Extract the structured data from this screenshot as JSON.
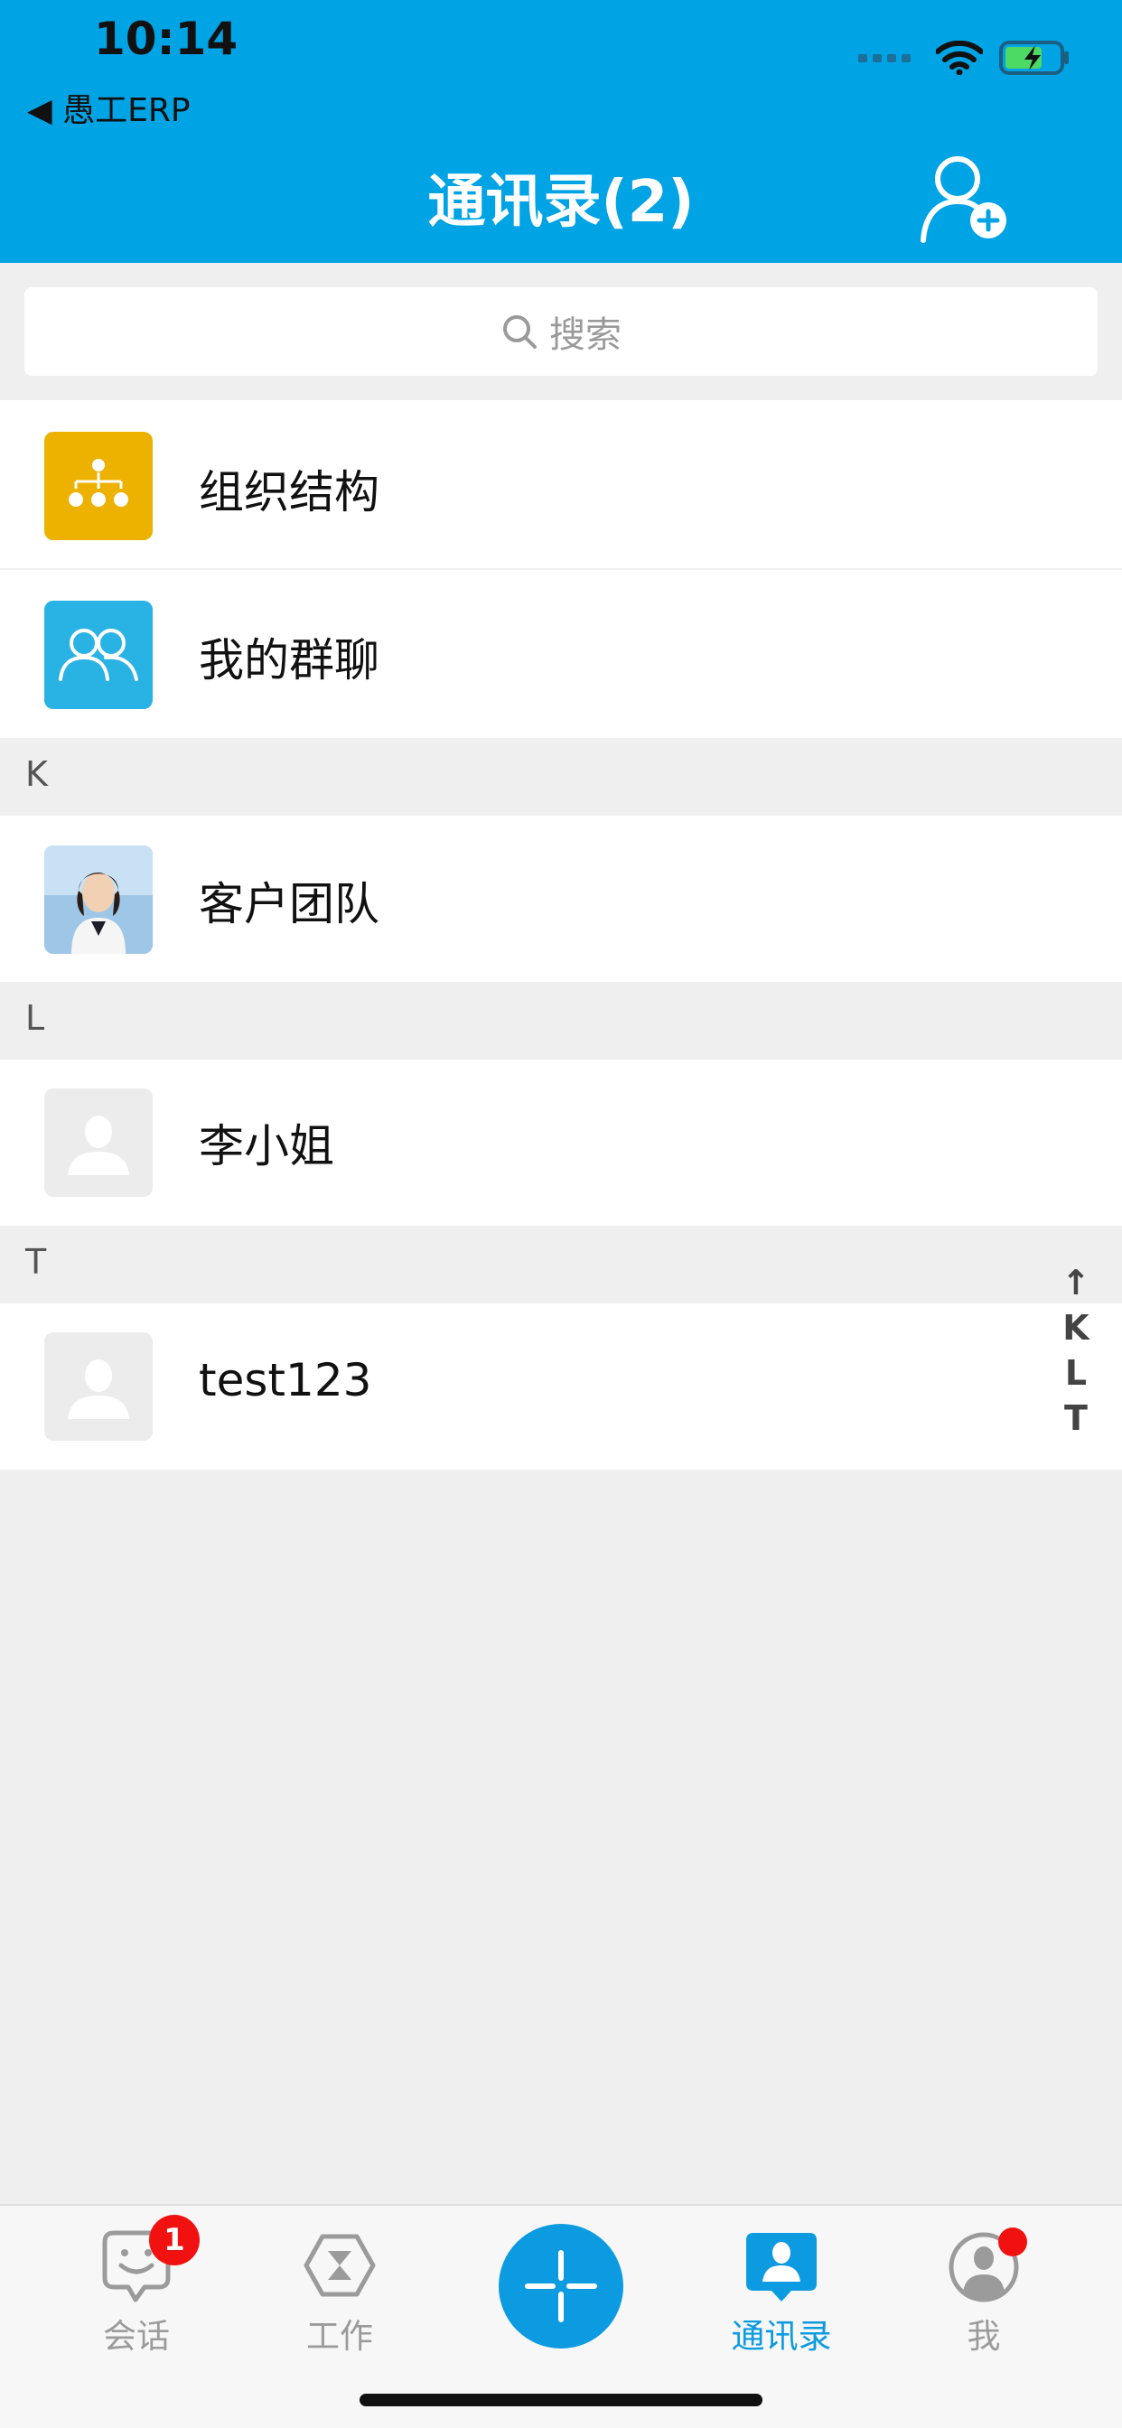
{
  "status_bar": {
    "time": "10:14",
    "back_app": "◀ 愚工ERP"
  },
  "nav": {
    "title": "通讯录(2)"
  },
  "search": {
    "placeholder": "搜索"
  },
  "top_items": [
    {
      "label": "组织结构",
      "icon": "org-structure-icon",
      "color": "#edb100"
    },
    {
      "label": "我的群聊",
      "icon": "group-chat-icon",
      "color": "#29b3e4"
    }
  ],
  "sections": [
    {
      "letter": "K",
      "contacts": [
        {
          "name": "客户团队",
          "avatar": "photo"
        }
      ]
    },
    {
      "letter": "L",
      "contacts": [
        {
          "name": "李小姐",
          "avatar": "placeholder"
        }
      ]
    },
    {
      "letter": "T",
      "contacts": [
        {
          "name": "test123",
          "avatar": "placeholder"
        }
      ]
    }
  ],
  "index_bar": [
    "↑",
    "K",
    "L",
    "T"
  ],
  "tabs": [
    {
      "label": "会话",
      "icon": "chat-face-icon",
      "badge": "1"
    },
    {
      "label": "工作",
      "icon": "hourglass-icon"
    },
    {
      "label": "",
      "icon": "plus-icon"
    },
    {
      "label": "通讯录",
      "icon": "contacts-icon",
      "active": true
    },
    {
      "label": "我",
      "icon": "profile-icon",
      "dot": true
    }
  ],
  "colors": {
    "primary": "#00a3e4",
    "accent": "#0c9be0",
    "badge": "#f11111",
    "background": "#efefef"
  }
}
